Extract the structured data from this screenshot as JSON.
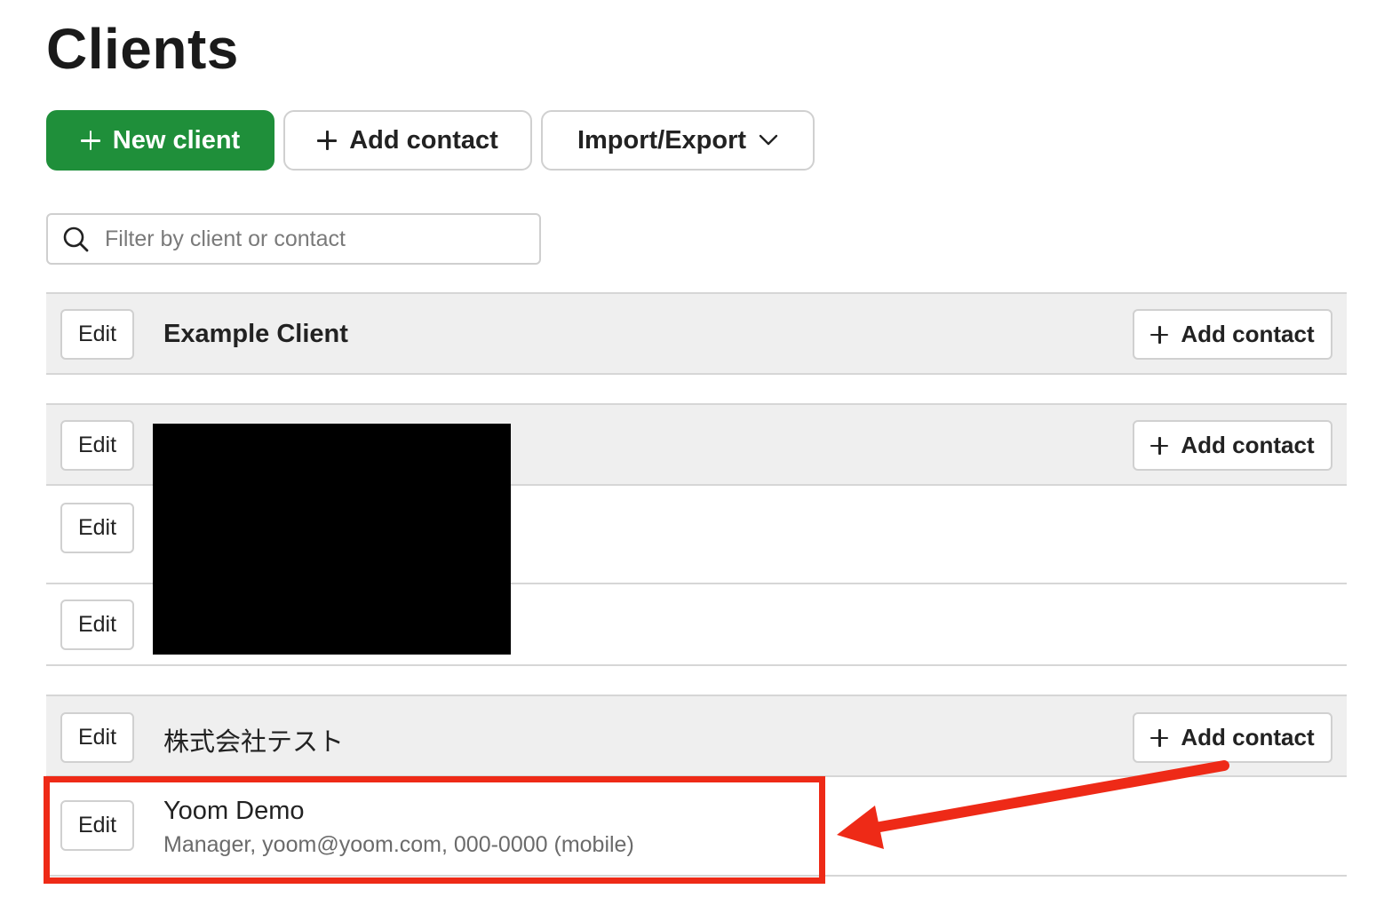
{
  "page": {
    "title": "Clients"
  },
  "toolbar": {
    "new_client_label": "New client",
    "add_contact_label": "Add contact",
    "import_export_label": "Import/Export"
  },
  "search": {
    "placeholder": "Filter by client or contact",
    "value": ""
  },
  "common": {
    "edit_label": "Edit",
    "add_contact_label": "Add contact"
  },
  "clients": [
    {
      "name": "Example Client",
      "contacts": []
    },
    {
      "name": "",
      "redacted": true,
      "contacts": [
        {
          "name": ""
        },
        {
          "name": ""
        }
      ]
    },
    {
      "name": "株式会社テスト",
      "contacts": [
        {
          "name": "Yoom Demo",
          "detail": "Manager, yoom@yoom.com, 000-0000 (mobile)"
        }
      ]
    }
  ],
  "colors": {
    "primary": "#1f8f3a",
    "row_header_bg": "#efefef",
    "annotation": "#ee2a17"
  },
  "icons": [
    "plus-icon",
    "chevron-down-icon",
    "search-icon"
  ]
}
